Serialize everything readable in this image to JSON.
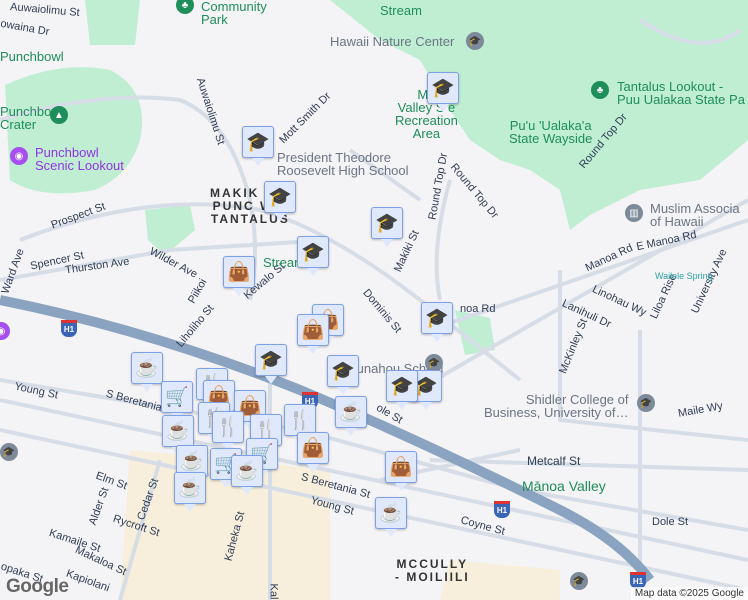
{
  "map": {
    "attribution": "Map data ©2025 Google",
    "logo": "Google",
    "colors": {
      "park": "#bfeed3",
      "road": "#d7dde6",
      "highway": "#8aa3c0",
      "marker_bg": "#dfe9fb",
      "marker_icon": "#0d3f63"
    },
    "neighborhoods": {
      "makiki": "MAKIKI HEIGHTS/ PUNCHBOWL/ TANTALUS",
      "makiki_visible": [
        "MAKIK   ER/",
        "PUNC    WL/",
        "TANTALUS"
      ],
      "mccully": [
        "MCCULLY",
        "- MOILIILI"
      ]
    },
    "places": {
      "community_park": [
        "Community",
        "Park"
      ],
      "manoa_stream": "Stream",
      "hawaii_nature_center": "Hawaii Nature Center",
      "punchbowl": "Punchbowl",
      "punchbowl_crater": [
        "Punchbowl",
        "Crater"
      ],
      "punchbowl_lookout": [
        "Punchbowl",
        "Scenic Lookout"
      ],
      "makiki_valley": [
        "Ma",
        "Valley S  e",
        "Recreation",
        "Area"
      ],
      "tantalus_lookout": [
        "Tantalus Lookout -",
        "Puu Ualakaa State Pa"
      ],
      "puu_ualakaa": [
        "Pu'u 'Ualaka'a",
        "State Wayside"
      ],
      "roosevelt": [
        "President Theodore",
        "Roosevelt High School"
      ],
      "muslim_assoc": [
        "Muslim Associa",
        "of Hawaii"
      ],
      "wailele_spring": "Wailele Spring",
      "shidler": [
        "Shidler College of",
        "Business, University of…"
      ],
      "manoa_valley": "Mānoa Valley",
      "stream2": "Stream",
      "school_label": "Punahou School"
    },
    "streets": [
      "Auwaiolimu St",
      "owaina Dr",
      "Auwaiolimu St",
      "Mott Smith Dr",
      "Prospect St",
      "Spencer St",
      "Thurston Ave",
      "Wilder Ave",
      "Ward Ave",
      "Piikoi",
      "Kewalo St",
      "Liholiho St",
      "Dominis St",
      "Makiki St",
      "Round Top Dr",
      "Round Top Dr",
      "Round Top Dr",
      "Manoa Rd",
      "E Manoa Rd",
      "noa Rd",
      "Linohau Wy",
      "Lanihuli Dr",
      "Liloa Rise",
      "University Ave",
      "McKinley St",
      "Maile Wy",
      "Metcalf St",
      "Dole St",
      "Coyne St",
      "Young St",
      "S Beretania",
      "Young St",
      "S Beretania St",
      "Elm St",
      "Alder St",
      "Cedar St",
      "Rycroft St",
      "Kamaile St",
      "Makaloa St",
      "Kaheka St",
      "Kapiolani",
      "opaka St",
      "ole St",
      "Kal"
    ],
    "highway_shield": "H1",
    "marker_types": {
      "school": "graduation-cap",
      "shop": "shopping-bag",
      "coffee": "coffee-cup",
      "food": "fork-knife",
      "grocery": "shopping-cart"
    }
  }
}
